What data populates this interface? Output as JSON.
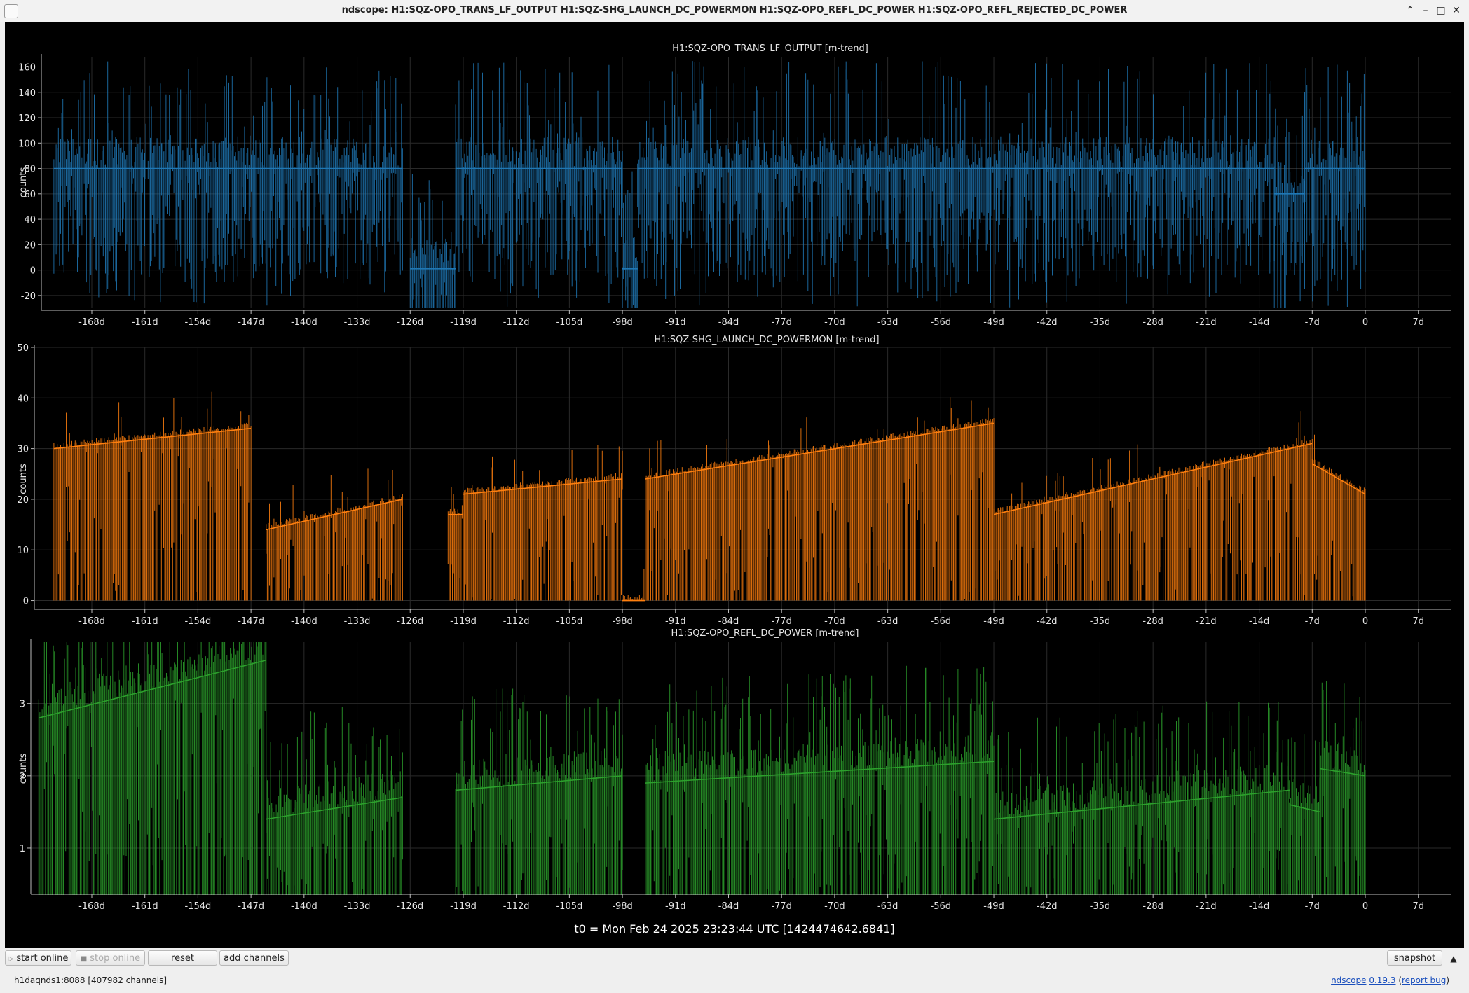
{
  "window": {
    "title": "ndscope: H1:SQZ-OPO_TRANS_LF_OUTPUT H1:SQZ-SHG_LAUNCH_DC_POWERMON H1:SQZ-OPO_REFL_DC_POWER H1:SQZ-OPO_REFL_REJECTED_DC_POWER"
  },
  "x_ticks": [
    "-168d",
    "-161d",
    "-154d",
    "-147d",
    "-140d",
    "-133d",
    "-126d",
    "-119d",
    "-112d",
    "-105d",
    "-98d",
    "-91d",
    "-84d",
    "-77d",
    "-70d",
    "-63d",
    "-56d",
    "-49d",
    "-42d",
    "-35d",
    "-28d",
    "-21d",
    "-14d",
    "-7d",
    "0",
    "7d"
  ],
  "x_tick_values": [
    -168,
    -161,
    -154,
    -147,
    -140,
    -133,
    -126,
    -119,
    -112,
    -105,
    -98,
    -91,
    -84,
    -77,
    -70,
    -63,
    -56,
    -49,
    -42,
    -35,
    -28,
    -21,
    -14,
    -7,
    0,
    7
  ],
  "colors": {
    "blue": "#1f77b4",
    "orange": "#ff7f0e",
    "green": "#2ca02c",
    "background": "#000000"
  },
  "chart_data": [
    {
      "type": "line",
      "title": "H1:SQZ-OPO_TRANS_LF_OUTPUT [m-trend]",
      "ylabel": "counts",
      "y_ticks": [
        "-20",
        "0",
        "20",
        "40",
        "60",
        "80",
        "100",
        "120",
        "140",
        "160"
      ],
      "y_tick_values": [
        -20,
        0,
        20,
        40,
        60,
        80,
        100,
        120,
        140,
        160
      ],
      "ylim": [
        -30,
        168
      ],
      "xlim": [
        -175,
        11
      ],
      "grid": true,
      "series": [
        {
          "color": "#1f77b4",
          "segments": [
            {
              "start": -173,
              "end": -127,
              "level": 80
            },
            {
              "start": -126,
              "end": -120,
              "level": 1
            },
            {
              "start": -120,
              "end": -98,
              "level": 80
            },
            {
              "start": -98,
              "end": -96,
              "level": 1
            },
            {
              "start": -96,
              "end": -12,
              "level": 80
            },
            {
              "start": -12,
              "end": -8,
              "level": 60
            },
            {
              "start": -8,
              "end": 0,
              "level": 80
            }
          ]
        }
      ]
    },
    {
      "type": "line",
      "title": "H1:SQZ-SHG_LAUNCH_DC_POWERMON [m-trend]",
      "ylabel": "counts",
      "y_ticks": [
        "0",
        "10",
        "20",
        "30",
        "40",
        "50"
      ],
      "y_tick_values": [
        0,
        10,
        20,
        30,
        40,
        50
      ],
      "ylim": [
        -2,
        50
      ],
      "xlim": [
        -175,
        11
      ],
      "grid": true,
      "series": [
        {
          "color": "#ff7f0e",
          "segments": [
            {
              "start": -173,
              "end": -147,
              "y0": 30,
              "y1": 34
            },
            {
              "start": -145,
              "end": -127,
              "y0": 14,
              "y1": 20
            },
            {
              "start": -121,
              "end": -119,
              "y0": 17,
              "y1": 17
            },
            {
              "start": -119,
              "end": -98,
              "y0": 21,
              "y1": 24
            },
            {
              "start": -98,
              "end": -95,
              "y0": 0,
              "y1": 0
            },
            {
              "start": -95,
              "end": -49,
              "y0": 24,
              "y1": 35
            },
            {
              "start": -49,
              "end": -7,
              "y0": 17,
              "y1": 31
            },
            {
              "start": -7,
              "end": 0,
              "y0": 27,
              "y1": 21
            }
          ]
        }
      ]
    },
    {
      "type": "line",
      "title": "H1:SQZ-OPO_REFL_DC_POWER [m-trend]",
      "ylabel": "counts",
      "y_ticks": [
        "1",
        "2",
        "3"
      ],
      "y_tick_values": [
        1,
        2,
        3
      ],
      "ylim": [
        0.35,
        3.85
      ],
      "xlim": [
        -175,
        11
      ],
      "grid": true,
      "series": [
        {
          "color": "#2ca02c",
          "segments": [
            {
              "start": -175,
              "end": -145,
              "y0": 2.8,
              "y1": 3.6
            },
            {
              "start": -145,
              "end": -127,
              "y0": 1.4,
              "y1": 1.7
            },
            {
              "start": -120,
              "end": -98,
              "y0": 1.8,
              "y1": 2.0
            },
            {
              "start": -95,
              "end": -49,
              "y0": 1.9,
              "y1": 2.2
            },
            {
              "start": -49,
              "end": -10,
              "y0": 1.4,
              "y1": 1.8
            },
            {
              "start": -10,
              "end": -6,
              "y0": 1.6,
              "y1": 1.5
            },
            {
              "start": -6,
              "end": 0,
              "y0": 2.1,
              "y1": 2.0
            }
          ]
        }
      ]
    }
  ],
  "t0_label": "t0 = Mon Feb 24 2025 23:23:44 UTC [1424474642.6841]",
  "toolbar": {
    "start_online": "start online",
    "stop_online": "stop online",
    "reset": "reset",
    "add_channels": "add channels",
    "snapshot": "snapshot"
  },
  "status": {
    "server": "h1daqnds1:8088  [407982 channels]",
    "app_name": "ndscope",
    "version": "0.19.3",
    "report_bug": "report bug"
  }
}
